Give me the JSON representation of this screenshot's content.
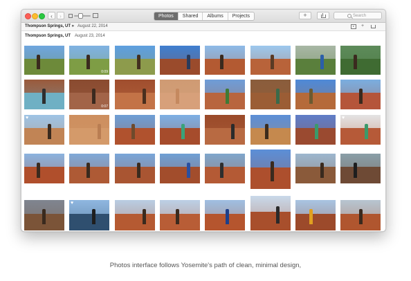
{
  "toolbar": {
    "tabs": [
      "Photos",
      "Shared",
      "Albums",
      "Projects"
    ],
    "active_tab": 0,
    "back_glyph": "‹",
    "forward_glyph": "›",
    "add_glyph": "+",
    "search_placeholder": "Search",
    "icons": [
      "back-arrow-icon",
      "forward-arrow-icon",
      "zoom-slider",
      "add-icon",
      "share-icon",
      "search-icon"
    ]
  },
  "header": {
    "location": "Thompson Springs, UT",
    "separator": "»",
    "date": "August 22, 2014",
    "add_glyph": "+",
    "icons": [
      "slideshow-icon",
      "add-icon",
      "share-icon"
    ]
  },
  "section": {
    "location": "Thompson Springs, UT",
    "date": "August 23, 2014"
  },
  "photos": [
    {
      "sky": "#6fa6df",
      "ground": "#6d8a3a",
      "fig": "#3a2a1e"
    },
    {
      "sky": "#7fb2e3",
      "ground": "#7e9d45",
      "fig": "#3b2a1f",
      "duration": "0:09"
    },
    {
      "sky": "#5e9fe0",
      "ground": "#8d9b4c",
      "fig": "#43301f"
    },
    {
      "sky": "#3f7fd0",
      "ground": "#9a4b2c",
      "fig": "#2a3b5c"
    },
    {
      "sky": "#8dbbe8",
      "ground": "#b35a32",
      "fig": "#3a2a1e"
    },
    {
      "sky": "#9cc8ee",
      "ground": "#b8633a",
      "fig": "#5a3a24"
    },
    {
      "sky": "#a8b7a5",
      "ground": "#5a7f3c",
      "fig": "#2c5fa8"
    },
    {
      "sky": "#5d8b5a",
      "ground": "#3f6b32",
      "fig": "#3b2a1f"
    },
    {
      "sky": "#9a5a3c",
      "ground": "#6fb0c4",
      "fig": "#2e2e2e"
    },
    {
      "sky": "#8a4b30",
      "ground": "#a26448",
      "fig": "#3b2a1f",
      "duration": "0:07"
    },
    {
      "sky": "#a04e2e",
      "ground": "#c37347",
      "fig": "#4a2f1e"
    },
    {
      "sky": "#cf9b74",
      "ground": "#d7a07a",
      "fig": "#c5895f"
    },
    {
      "sky": "#6e9dd8",
      "ground": "#b8653e",
      "fig": "#3f7a35"
    },
    {
      "sky": "#8a5d3c",
      "ground": "#9b5d35",
      "fig": "#3a6a4a"
    },
    {
      "sky": "#4e8ad8",
      "ground": "#b56a3a",
      "fig": "#6b5a30"
    },
    {
      "sky": "#7aaee0",
      "ground": "#b5553a",
      "fig": "#3a2a1e"
    },
    {
      "sky": "#9ec4e6",
      "ground": "#c18455",
      "fig": "#3a2a1e",
      "heart": true
    },
    {
      "sky": "#cd8f5f",
      "ground": "#d49a6a",
      "fig": "#b97d52"
    },
    {
      "sky": "#6d9fd6",
      "ground": "#b0522e",
      "fig": "#6e4a2c"
    },
    {
      "sky": "#7db0e5",
      "ground": "#a64c2c",
      "fig": "#3aa37a"
    },
    {
      "sky": "#9a4a2a",
      "ground": "#b86a42",
      "fig": "#2b2b2b"
    },
    {
      "sky": "#5b8fd8",
      "ground": "#c5894e",
      "fig": "#3c2c1c"
    },
    {
      "sky": "#5f7ec8",
      "ground": "#9a4a30",
      "fig": "#3b9a6a"
    },
    {
      "sky": "#e4e4e4",
      "ground": "#b65a38",
      "fig": "#3b9a6a",
      "heart": true
    },
    {
      "sky": "#8bb3df",
      "ground": "#b04f2c",
      "fig": "#3a2a1e"
    },
    {
      "sky": "#7fa9d8",
      "ground": "#ae5a35",
      "fig": "#3a2a1e"
    },
    {
      "sky": "#79a6d9",
      "ground": "#a95532",
      "fig": "#3a2a1e"
    },
    {
      "sky": "#6fa0d5",
      "ground": "#a24d2c",
      "fig": "#2a4fa0"
    },
    {
      "sky": "#7ea6cc",
      "ground": "#b45a35",
      "fig": "#2e2e2e"
    },
    {
      "sky": "#5b8fd8",
      "ground": "#ad4f2d",
      "fig": "#3a2a1e"
    },
    {
      "sky": "#9db7cf",
      "ground": "#8a5a3a",
      "fig": "#3a2a1e"
    },
    {
      "sky": "#8a9fa8",
      "ground": "#6e4a35",
      "fig": "#1e1e1e"
    },
    {
      "sky": "#7f8590",
      "ground": "#7b5438",
      "fig": "#3a2a1e"
    },
    {
      "sky": "#8fb7e0",
      "ground": "#2f4f6f",
      "fig": "#1e1e1e",
      "heart": true
    },
    {
      "sky": "#b9cde3",
      "ground": "#b55a32",
      "fig": "#3a2a1e"
    },
    {
      "sky": "#bcd0e6",
      "ground": "#b85d36",
      "fig": "#3a2a1e"
    },
    {
      "sky": "#9fbfe2",
      "ground": "#b5552e",
      "fig": "#1e3f8a"
    },
    {
      "sky": "#c9d9ea",
      "ground": "#a84f2c",
      "fig": "#2a2a2a"
    },
    {
      "sky": "#a8c4e2",
      "ground": "#9c4a2b",
      "fig": "#e0a020"
    },
    {
      "sky": "#b7c5d1",
      "ground": "#b0562f",
      "fig": "#3a2a1e"
    }
  ],
  "caption": "Photos interface follows Yosemite's path of clean, minimal design,"
}
